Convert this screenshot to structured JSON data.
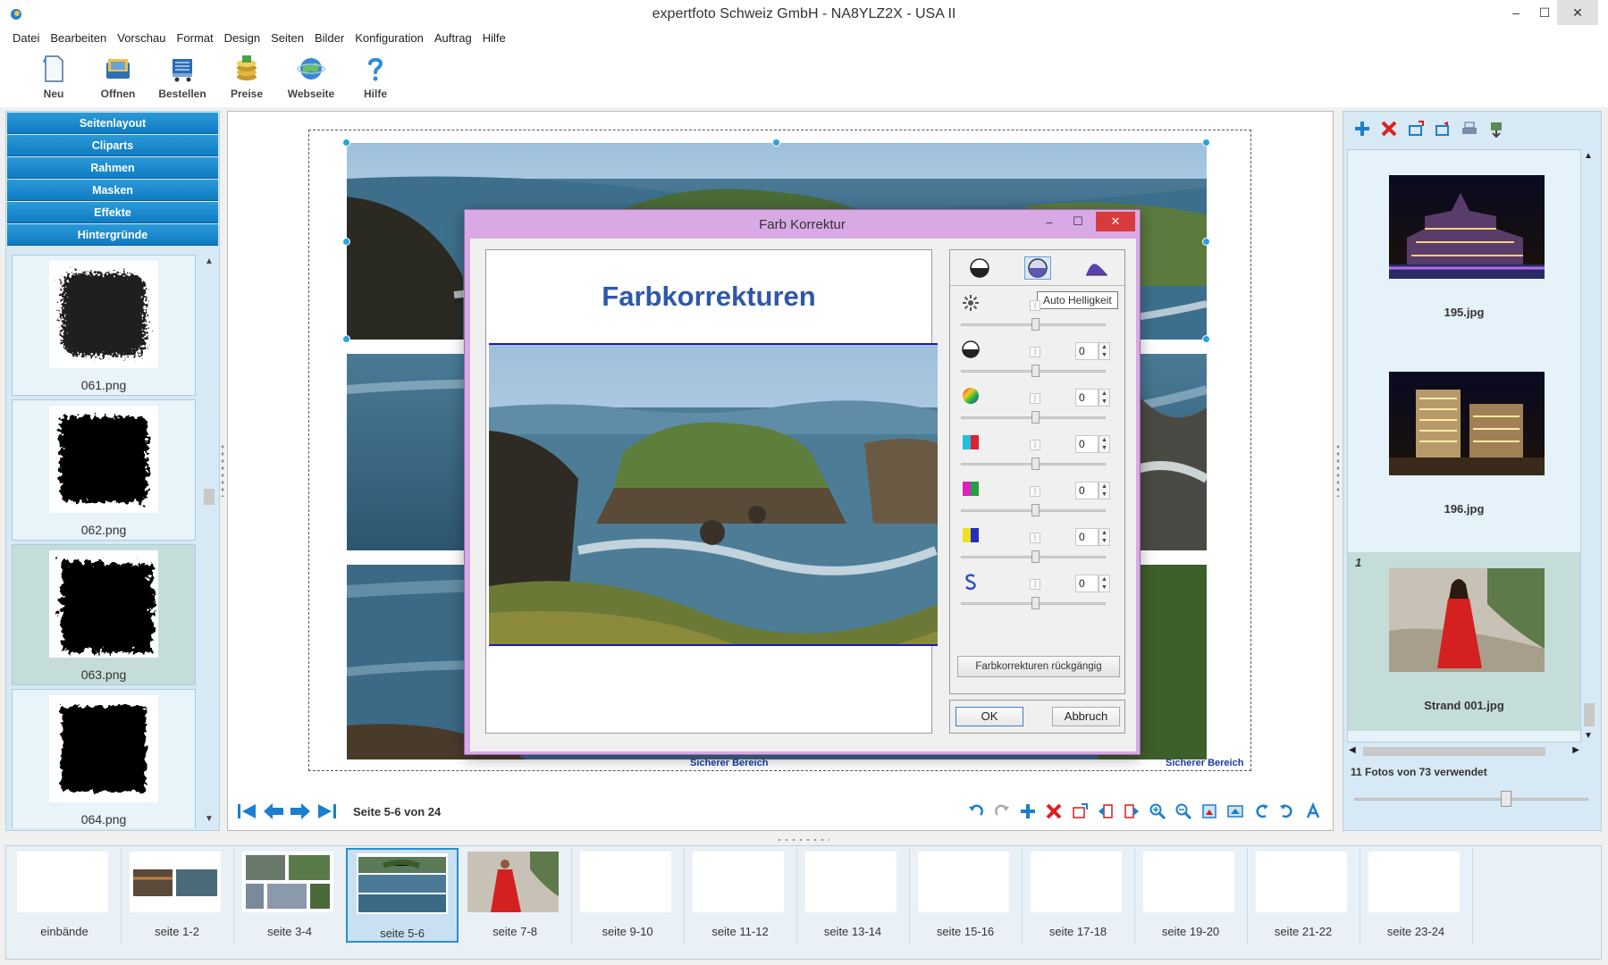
{
  "window": {
    "title": "expertfoto Schweiz GmbH - NA8YLZ2X - USA II",
    "minimize": "–",
    "maximize": "☐",
    "close": "✕"
  },
  "menu": [
    "Datei",
    "Bearbeiten",
    "Vorschau",
    "Format",
    "Design",
    "Seiten",
    "Bilder",
    "Konfiguration",
    "Auftrag",
    "Hilfe"
  ],
  "toolbar": {
    "new": "Neu",
    "open": "Offnen",
    "order": "Bestellen",
    "prices": "Preise",
    "website": "Webseite",
    "help": "Hilfe"
  },
  "left_panel": {
    "sections": [
      "Seitenlayout",
      "Cliparts",
      "Rahmen",
      "Masken",
      "Effekte",
      "Hintergründe"
    ],
    "masks": [
      "061.png",
      "062.png",
      "063.png",
      "064.png"
    ],
    "selected_mask": "063.png"
  },
  "canvas": {
    "safe_area_left": "Sicherer Bereich",
    "safe_area_right": "Sicherer Bereich",
    "page_info": "Seite 5-6 von 24"
  },
  "dialog": {
    "title": "Farb Korrektur",
    "minimize": "–",
    "maximize": "☐",
    "close": "✕",
    "preview_heading": "Farbkorrekturen",
    "tooltip": "Auto Helligkeit",
    "adjustments": [
      {
        "icon": "brightness-icon",
        "value": ""
      },
      {
        "icon": "contrast-icon",
        "value": "0"
      },
      {
        "icon": "saturation-icon",
        "value": "0"
      },
      {
        "icon": "cyan-red-icon",
        "value": "0"
      },
      {
        "icon": "magenta-green-icon",
        "value": "0"
      },
      {
        "icon": "yellow-blue-icon",
        "value": "0"
      },
      {
        "icon": "sharpness-icon",
        "value": "0"
      }
    ],
    "reset": "Farbkorrekturen rückgängig",
    "ok": "OK",
    "cancel": "Abbruch"
  },
  "right_panel": {
    "photos": [
      {
        "name": "195.jpg",
        "count": ""
      },
      {
        "name": "196.jpg",
        "count": ""
      },
      {
        "name": "Strand 001.jpg",
        "count": "1"
      }
    ],
    "selected_photo": "Strand 001.jpg",
    "photo_count": "11 Fotos von 73 verwendet"
  },
  "pages": [
    "einbände",
    "seite 1-2",
    "seite 3-4",
    "seite 5-6",
    "seite 7-8",
    "seite 9-10",
    "seite 11-12",
    "seite 13-14",
    "seite 15-16",
    "seite 17-18",
    "seite 19-20",
    "seite 21-22",
    "seite 23-24"
  ],
  "selected_page": "seite 5-6",
  "colors": {
    "accent_blue": "#0f7bc2",
    "dialog_purple": "#d9a9e6",
    "heading_blue": "#2e58a8",
    "close_red": "#d83b3b"
  }
}
